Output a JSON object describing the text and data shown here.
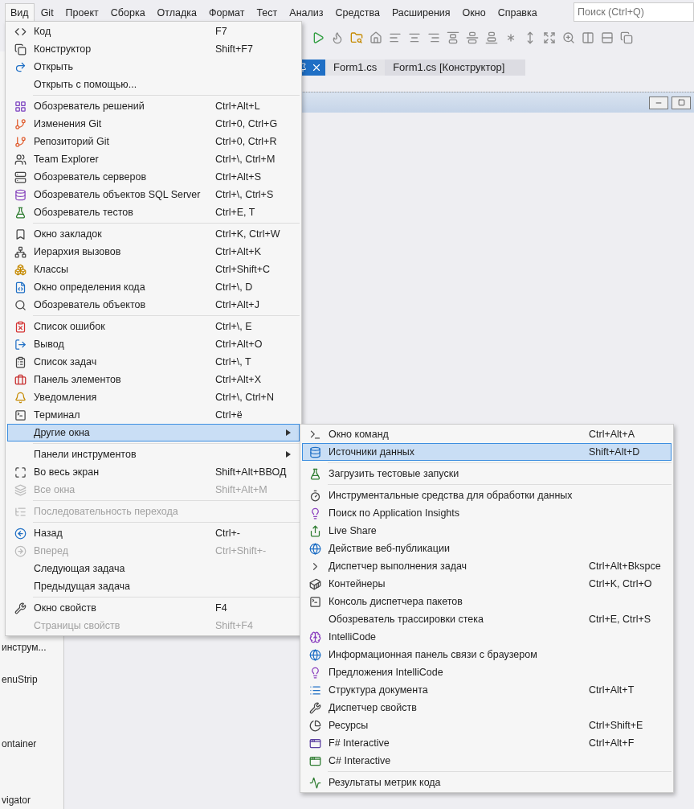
{
  "menu_bar": {
    "items": [
      {
        "label": "Вид",
        "selected": true
      },
      {
        "label": "Git",
        "selected": false
      },
      {
        "label": "Проект",
        "selected": false
      },
      {
        "label": "Сборка",
        "selected": false
      },
      {
        "label": "Отладка",
        "selected": false
      },
      {
        "label": "Формат",
        "selected": false
      },
      {
        "label": "Тест",
        "selected": false
      },
      {
        "label": "Анализ",
        "selected": false
      },
      {
        "label": "Средства",
        "selected": false
      },
      {
        "label": "Расширения",
        "selected": false
      },
      {
        "label": "Окно",
        "selected": false
      },
      {
        "label": "Справка",
        "selected": false
      }
    ],
    "search": {
      "placeholder": "Поиск (Ctrl+Q)"
    }
  },
  "editor_tabs": [
    {
      "label": "Form1.cs",
      "selected": false
    },
    {
      "label": "Form1.cs [Конструктор]",
      "selected": false
    }
  ],
  "left_panel": {
    "items": [
      "инструм...",
      "enuStrip",
      "ontainer",
      "vigator"
    ]
  },
  "view_menu": {
    "items": [
      {
        "kind": "item",
        "label": "Код",
        "shortcut": "F7",
        "disabled": false,
        "selected": false
      },
      {
        "kind": "item",
        "label": "Конструктор",
        "shortcut": "Shift+F7",
        "disabled": false,
        "selected": false
      },
      {
        "kind": "item",
        "label": "Открыть",
        "disabled": false,
        "selected": false
      },
      {
        "kind": "item",
        "label": "Открыть с помощью...",
        "disabled": false,
        "selected": false
      },
      {
        "kind": "separator"
      },
      {
        "kind": "item",
        "label": "Обозреватель решений",
        "shortcut": "Ctrl+Alt+L",
        "disabled": false,
        "selected": false
      },
      {
        "kind": "item",
        "label": "Изменения Git",
        "shortcut": "Ctrl+0, Ctrl+G",
        "disabled": false,
        "selected": false
      },
      {
        "kind": "item",
        "label": "Репозиторий Git",
        "shortcut": "Ctrl+0, Ctrl+R",
        "disabled": false,
        "selected": false
      },
      {
        "kind": "item",
        "label": "Team Explorer",
        "shortcut": "Ctrl+\\, Ctrl+M",
        "disabled": false,
        "selected": false
      },
      {
        "kind": "item",
        "label": "Обозреватель серверов",
        "shortcut": "Ctrl+Alt+S",
        "disabled": false,
        "selected": false
      },
      {
        "kind": "item",
        "label": "Обозреватель объектов SQL Server",
        "shortcut": "Ctrl+\\, Ctrl+S",
        "disabled": false,
        "selected": false
      },
      {
        "kind": "item",
        "label": "Обозреватель тестов",
        "shortcut": "Ctrl+E, T",
        "disabled": false,
        "selected": false
      },
      {
        "kind": "separator"
      },
      {
        "kind": "item",
        "label": "Окно закладок",
        "shortcut": "Ctrl+K, Ctrl+W",
        "disabled": false,
        "selected": false
      },
      {
        "kind": "item",
        "label": "Иерархия вызовов",
        "shortcut": "Ctrl+Alt+K",
        "disabled": false,
        "selected": false
      },
      {
        "kind": "item",
        "label": "Классы",
        "shortcut": "Ctrl+Shift+C",
        "disabled": false,
        "selected": false
      },
      {
        "kind": "item",
        "label": "Окно определения кода",
        "shortcut": "Ctrl+\\, D",
        "disabled": false,
        "selected": false
      },
      {
        "kind": "item",
        "label": "Обозреватель объектов",
        "shortcut": "Ctrl+Alt+J",
        "disabled": false,
        "selected": false
      },
      {
        "kind": "separator"
      },
      {
        "kind": "item",
        "label": "Список ошибок",
        "shortcut": "Ctrl+\\, E",
        "disabled": false,
        "selected": false
      },
      {
        "kind": "item",
        "label": "Вывод",
        "shortcut": "Ctrl+Alt+O",
        "disabled": false,
        "selected": false
      },
      {
        "kind": "item",
        "label": "Список задач",
        "shortcut": "Ctrl+\\, T",
        "disabled": false,
        "selected": false
      },
      {
        "kind": "item",
        "label": "Панель элементов",
        "shortcut": "Ctrl+Alt+X",
        "disabled": false,
        "selected": false
      },
      {
        "kind": "item",
        "label": "Уведомления",
        "shortcut": "Ctrl+\\, Ctrl+N",
        "disabled": false,
        "selected": false
      },
      {
        "kind": "item",
        "label": "Терминал",
        "shortcut": "Ctrl+ё",
        "disabled": false,
        "selected": false
      },
      {
        "kind": "submenu",
        "label": "Другие окна",
        "disabled": false,
        "selected": true
      },
      {
        "kind": "separator"
      },
      {
        "kind": "submenu",
        "label": "Панели инструментов",
        "disabled": false,
        "selected": false
      },
      {
        "kind": "item",
        "label": "Во весь экран",
        "shortcut": "Shift+Alt+ВВОД",
        "disabled": false,
        "selected": false
      },
      {
        "kind": "item",
        "label": "Все окна",
        "shortcut": "Shift+Alt+M",
        "disabled": true,
        "selected": false
      },
      {
        "kind": "separator"
      },
      {
        "kind": "item",
        "label": "Последовательность перехода",
        "disabled": true,
        "selected": false
      },
      {
        "kind": "separator"
      },
      {
        "kind": "item",
        "label": "Назад",
        "shortcut": "Ctrl+-",
        "disabled": false,
        "selected": false
      },
      {
        "kind": "item",
        "label": "Вперед",
        "shortcut": "Ctrl+Shift+-",
        "disabled": true,
        "selected": false
      },
      {
        "kind": "item",
        "label": "Следующая задача",
        "disabled": false,
        "selected": false
      },
      {
        "kind": "item",
        "label": "Предыдущая задача",
        "disabled": false,
        "selected": false
      },
      {
        "kind": "separator"
      },
      {
        "kind": "item",
        "label": "Окно свойств",
        "shortcut": "F4",
        "disabled": false,
        "selected": false
      },
      {
        "kind": "item",
        "label": "Страницы свойств",
        "shortcut": "Shift+F4",
        "disabled": true,
        "selected": false
      }
    ]
  },
  "other_windows_menu": {
    "items": [
      {
        "kind": "item",
        "label": "Окно команд",
        "shortcut": "Ctrl+Alt+A",
        "disabled": false,
        "selected": false
      },
      {
        "kind": "item",
        "label": "Источники данных",
        "shortcut": "Shift+Alt+D",
        "disabled": false,
        "selected": true
      },
      {
        "kind": "separator"
      },
      {
        "kind": "item",
        "label": "Загрузить тестовые запуски",
        "disabled": false,
        "selected": false
      },
      {
        "kind": "separator"
      },
      {
        "kind": "item",
        "label": "Инструментальные средства для обработки данных",
        "disabled": false,
        "selected": false
      },
      {
        "kind": "item",
        "label": "Поиск по Application Insights",
        "disabled": false,
        "selected": false
      },
      {
        "kind": "item",
        "label": "Live Share",
        "disabled": false,
        "selected": false
      },
      {
        "kind": "item",
        "label": "Действие веб-публикации",
        "disabled": false,
        "selected": false
      },
      {
        "kind": "item",
        "label": "Диспетчер выполнения задач",
        "shortcut": "Ctrl+Alt+Bkspce",
        "disabled": false,
        "selected": false
      },
      {
        "kind": "item",
        "label": "Контейнеры",
        "shortcut": "Ctrl+K, Ctrl+O",
        "disabled": false,
        "selected": false
      },
      {
        "kind": "item",
        "label": "Консоль диспетчера пакетов",
        "disabled": false,
        "selected": false
      },
      {
        "kind": "item",
        "label": "Обозреватель трассировки стека",
        "shortcut": "Ctrl+E, Ctrl+S",
        "disabled": false,
        "selected": false
      },
      {
        "kind": "item",
        "label": "IntelliCode",
        "disabled": false,
        "selected": false
      },
      {
        "kind": "item",
        "label": "Информационная панель связи с браузером",
        "disabled": false,
        "selected": false
      },
      {
        "kind": "item",
        "label": "Предложения IntelliCode",
        "disabled": false,
        "selected": false
      },
      {
        "kind": "item",
        "label": "Структура документа",
        "shortcut": "Ctrl+Alt+T",
        "disabled": false,
        "selected": false
      },
      {
        "kind": "item",
        "label": "Диспетчер свойств",
        "disabled": false,
        "selected": false
      },
      {
        "kind": "item",
        "label": "Ресурсы",
        "shortcut": "Ctrl+Shift+E",
        "disabled": false,
        "selected": false
      },
      {
        "kind": "item",
        "label": "F# Interactive",
        "shortcut": "Ctrl+Alt+F",
        "disabled": false,
        "selected": false
      },
      {
        "kind": "item",
        "label": "C# Interactive",
        "disabled": false,
        "selected": false
      },
      {
        "kind": "separator"
      },
      {
        "kind": "item",
        "label": "Результаты метрик кода",
        "disabled": false,
        "selected": false
      }
    ]
  }
}
